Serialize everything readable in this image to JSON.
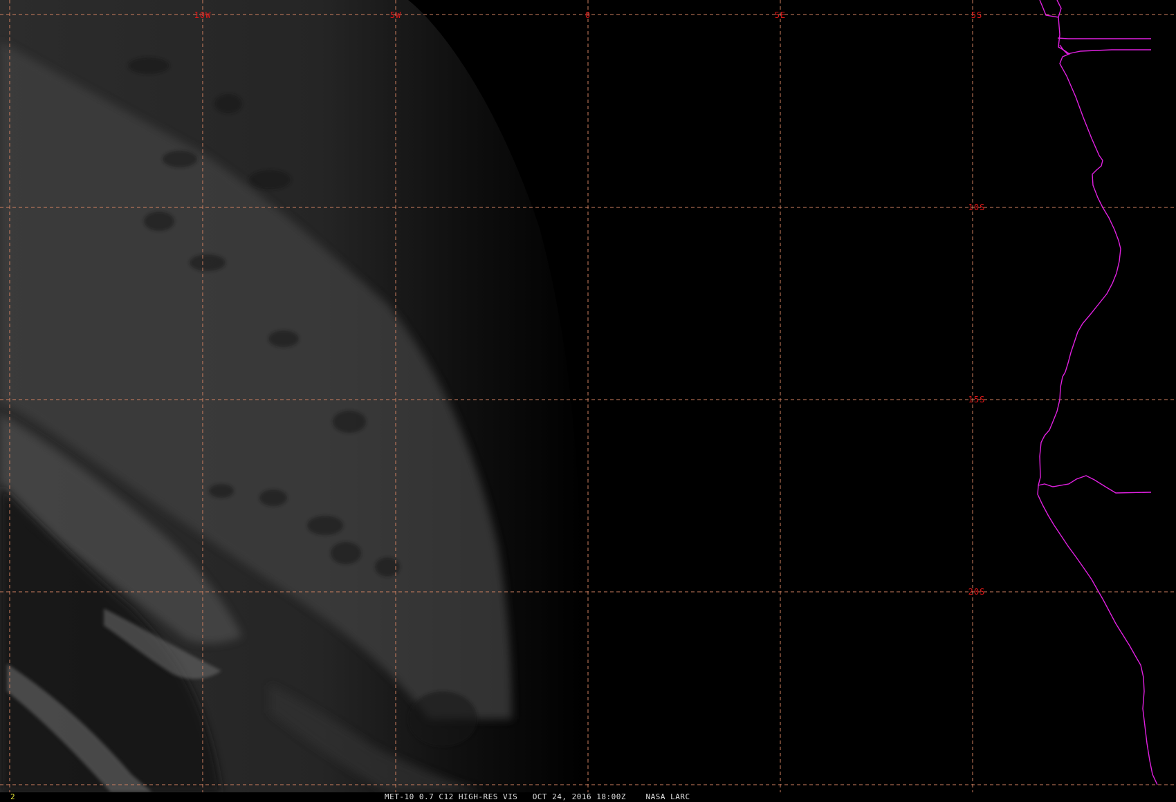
{
  "map": {
    "grid_color": "#d08060",
    "label_color": "#e01818",
    "boundary_color": "#e020e0",
    "longitude_labels": [
      "10W",
      "5W",
      "0",
      "5E"
    ],
    "latitude_labels": [
      "5S",
      "10S",
      "15S",
      "20S"
    ]
  },
  "status_bar": {
    "frame_number": "2",
    "product": "MET-10 0.7 C12 HIGH-RES VIS",
    "datetime": "OCT 24, 2016 18:00Z",
    "source": "NASA LARC"
  }
}
